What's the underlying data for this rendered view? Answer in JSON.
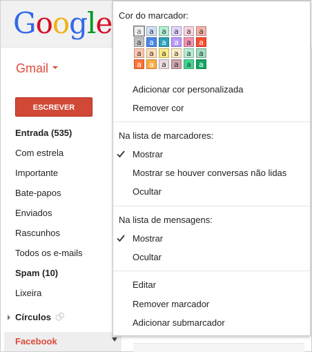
{
  "logo": {
    "letters": [
      {
        "ch": "G",
        "color": "#3369e8"
      },
      {
        "ch": "o",
        "color": "#d50f25"
      },
      {
        "ch": "o",
        "color": "#eeb211"
      },
      {
        "ch": "g",
        "color": "#3369e8"
      },
      {
        "ch": "l",
        "color": "#009925"
      },
      {
        "ch": "e",
        "color": "#d50f25"
      }
    ]
  },
  "gmail_menu": {
    "label": "Gmail"
  },
  "compose": {
    "label": "ESCREVER"
  },
  "nav": {
    "inbox": "Entrada (535)",
    "starred": "Com estrela",
    "important": "Importante",
    "chats": "Bate-papos",
    "sent": "Enviados",
    "drafts": "Rascunhos",
    "all_mail": "Todos os e-mails",
    "spam": "Spam (10)",
    "trash": "Lixeira",
    "circles": "Círculos",
    "facebook": "Facebook"
  },
  "menu": {
    "color_heading": "Cor do marcador:",
    "swatch_letter": "a",
    "swatches": [
      {
        "bg": "#f0f0f0",
        "fg": "#666666"
      },
      {
        "bg": "#d0e0f8",
        "fg": "#333333"
      },
      {
        "bg": "#b3efd3",
        "fg": "#333333"
      },
      {
        "bg": "#e3d7ff",
        "fg": "#333333"
      },
      {
        "bg": "#fbd3e0",
        "fg": "#333333"
      },
      {
        "bg": "#f2b2a8",
        "fg": "#333333"
      },
      {
        "bg": "#c2c2c2",
        "fg": "#333333"
      },
      {
        "bg": "#4986e7",
        "fg": "#ffffff"
      },
      {
        "bg": "#2da2bb",
        "fg": "#ffffff"
      },
      {
        "bg": "#b99aff",
        "fg": "#ffffff"
      },
      {
        "bg": "#f691b2",
        "fg": "#333333"
      },
      {
        "bg": "#fb4c2f",
        "fg": "#ffffff"
      },
      {
        "bg": "#ffc8af",
        "fg": "#333333"
      },
      {
        "bg": "#ffdeb5",
        "fg": "#333333"
      },
      {
        "bg": "#fbe983",
        "fg": "#333333"
      },
      {
        "bg": "#fdedc1",
        "fg": "#333333"
      },
      {
        "bg": "#b3efd3",
        "fg": "#333333"
      },
      {
        "bg": "#a2dcc1",
        "fg": "#333333"
      },
      {
        "bg": "#ff7537",
        "fg": "#ffffff"
      },
      {
        "bg": "#ffad46",
        "fg": "#ffffff"
      },
      {
        "bg": "#ebdbde",
        "fg": "#333333"
      },
      {
        "bg": "#cca6ac",
        "fg": "#333333"
      },
      {
        "bg": "#42d692",
        "fg": "#333333"
      },
      {
        "bg": "#16a765",
        "fg": "#ffffff"
      }
    ],
    "add_custom_color": "Adicionar cor personalizada",
    "remove_color": "Remover cor",
    "label_list_heading": "Na lista de marcadores:",
    "label_list_show": "Mostrar",
    "label_list_show_if_unread": "Mostrar se houver conversas não lidas",
    "label_list_hide": "Ocultar",
    "message_list_heading": "Na lista de mensagens:",
    "message_list_show": "Mostrar",
    "message_list_hide": "Ocultar",
    "edit": "Editar",
    "remove_label": "Remover marcador",
    "add_sublabel": "Adicionar submarcador"
  }
}
